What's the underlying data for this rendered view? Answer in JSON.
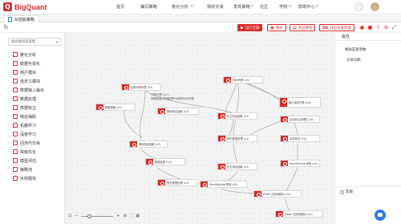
{
  "app": {
    "logo_letter": "Q",
    "logo_text": "BigQuant"
  },
  "nav": {
    "items": [
      "首页",
      "编写策略",
      "量化分析",
      "我的交易",
      "发现策略",
      "社区",
      "学院",
      "帮助中心"
    ]
  },
  "tabs": [
    {
      "label": "AI选股策略"
    }
  ],
  "toolbar": {
    "run_all": "运行全部",
    "save": "保存",
    "open_tutorial": "开启教程",
    "open_dev_env": "开启开发环境",
    "accent": "#d62c2c"
  },
  "modules": {
    "search_placeholder": "搜索模块和策略",
    "items": [
      "量化分析",
      "数据可视化",
      "用户模块",
      "自定义模块",
      "数据输入输出",
      "数据处理",
      "数据标注",
      "特征抽取",
      "机器学习",
      "深度学习",
      "回测与交易",
      "高级优化",
      "模型评估",
      "策略池",
      "示例模块"
    ]
  },
  "canvas": {
    "nodes": [
      {
        "id": "n1",
        "label": "证券代码列表 (v2)"
      },
      {
        "id": "n2",
        "label": "代码列表 (v3)"
      },
      {
        "id": "n3",
        "label": "输入特征列表 (v3)"
      },
      {
        "id": "n4",
        "label": "数据抽取 (v2)"
      },
      {
        "id": "n5",
        "label": "基础特征抽取 (v7)"
      },
      {
        "id": "n6",
        "label": "衍生特征抽取 (v3)"
      },
      {
        "id": "n7",
        "label": "自动标注(股票) (v2)"
      },
      {
        "id": "n8",
        "label": "缺失数据处理 (v1)"
      },
      {
        "id": "n9",
        "label": "合并特征 (v3)"
      },
      {
        "id": "n10",
        "label": "基础特征抽取 (v7)"
      },
      {
        "id": "n11",
        "label": "衍生特征抽取 (v3)"
      },
      {
        "id": "n12",
        "label": "StockRanker训练 (v5)"
      },
      {
        "id": "n13",
        "label": "数据连接 (v3)"
      },
      {
        "id": "n14",
        "label": "StockRanker预测 (v5)"
      },
      {
        "id": "n15",
        "label": "缺失数据处理 (v1)"
      },
      {
        "id": "n16",
        "label": "Trade (回测/模拟) (v4)"
      }
    ],
    "tooltip": [
      "代码列表 (v2)",
      "获取指定市场股票代码的代码列表"
    ],
    "zoom_minus": "−",
    "zoom_plus": "+"
  },
  "properties": {
    "title": "属性",
    "section": "模拟实盘参数",
    "field": "交易日期"
  },
  "help": {
    "label": "帮助"
  }
}
